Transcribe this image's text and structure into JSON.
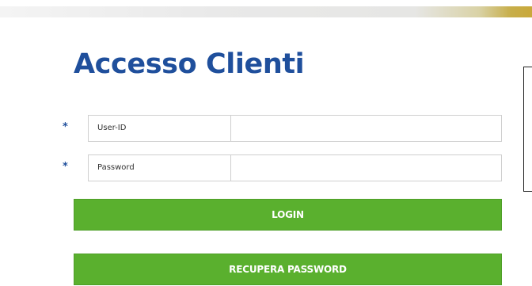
{
  "page": {
    "title": "Accesso Clienti"
  },
  "form": {
    "userid": {
      "required_mark": "*",
      "label": "User-ID",
      "value": ""
    },
    "password": {
      "required_mark": "*",
      "label": "Password",
      "value": ""
    },
    "login_label": "LOGIN",
    "recover_label": "RECUPERA PASSWORD"
  },
  "colors": {
    "title": "#1f4f9c",
    "button": "#5ab02e",
    "asterisk": "#1f4f9c"
  }
}
